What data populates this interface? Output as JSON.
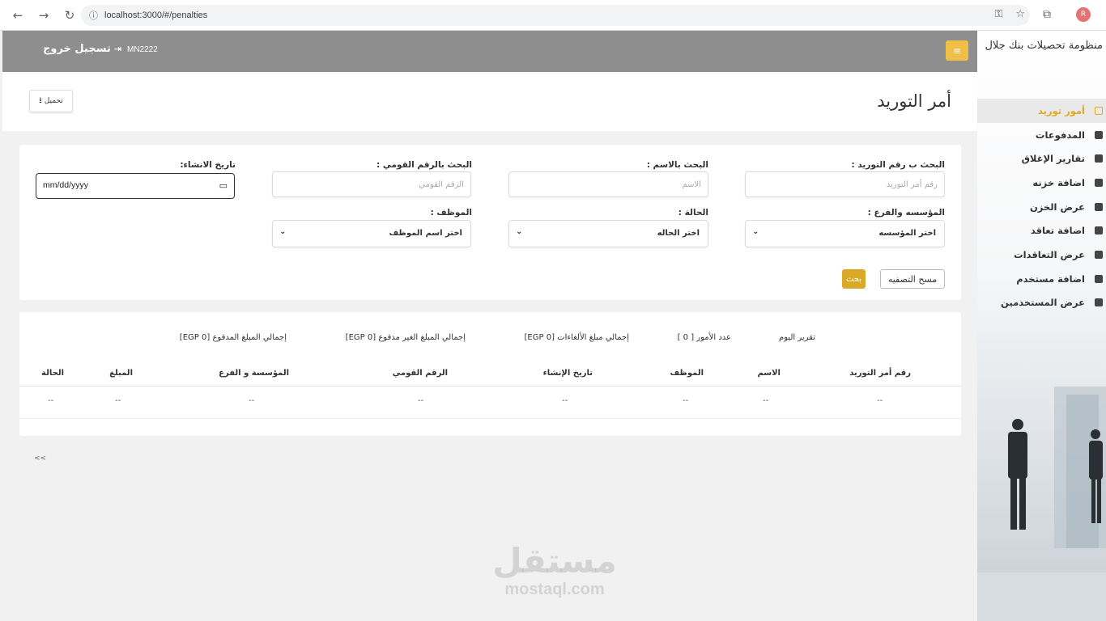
{
  "browser": {
    "url": "localhost:3000/#/penalties",
    "profile_initial": "R"
  },
  "sidebar": {
    "title": "منظومة تحصيلات بنك جلال",
    "items": [
      {
        "label": "أمور توريد",
        "icon": "invoice-icon",
        "active": true
      },
      {
        "label": "المدفوعات",
        "icon": "payments-icon"
      },
      {
        "label": "تقارير الإغلاق",
        "icon": "chart-icon"
      },
      {
        "label": "اضافة خزنه",
        "icon": "safe-add-icon"
      },
      {
        "label": "عرض الخزن",
        "icon": "safe-icon"
      },
      {
        "label": "اضافة تعاقد",
        "icon": "contract-add-icon"
      },
      {
        "label": "عرض التعاقدات",
        "icon": "contracts-icon"
      },
      {
        "label": "اضافة مستخدم",
        "icon": "user-add-icon"
      },
      {
        "label": "عرض المستخدمين",
        "icon": "users-icon"
      }
    ]
  },
  "header": {
    "user_code": "MN2222",
    "logout_label": "تسجيل خروج",
    "menu_icon": "hamburger-icon"
  },
  "page": {
    "title": "أمر التوريد",
    "download_label": "تحميل"
  },
  "filters": {
    "supply_no": {
      "label": "البحث ب رقم التوريد :",
      "placeholder": "رقم أمر التوريد"
    },
    "name": {
      "label": "البحث بالاسم :",
      "placeholder": "الاسم"
    },
    "national_id": {
      "label": "البحث بالرقم القومي :",
      "placeholder": "الرقم القومي"
    },
    "created_date": {
      "label": "تاريخ الانشاء:",
      "value": "mm/dd/yyyy"
    },
    "institution": {
      "label": "المؤسسه والفرع :",
      "value": "اختر المؤسسه"
    },
    "status": {
      "label": "الحالة :",
      "value": "اختر الحاله"
    },
    "employee": {
      "label": "الموظف :",
      "value": "اختر اسم الموظف"
    },
    "clear_label": "مسح التصفيه",
    "search_label": "بحث"
  },
  "summary": {
    "today_report": "تقرير اليوم",
    "orders_count": "عدد الأمور [ 0 ]",
    "total_cancellations": "إجمالي مبلغ الألغاءات [0 EGP]",
    "total_unpaid": "إجمالي المبلغ الغير مدفوع [0 EGP]",
    "total_paid": "إجمالي المبلغ المدفوع [0 EGP]"
  },
  "table": {
    "headers": [
      "رقم أمر التوريد",
      "الاسم",
      "الموظف",
      "تاريخ الإنشاء",
      "الرقم القومي",
      "المؤسسة و الفرع",
      "المبلغ",
      "الحالة"
    ],
    "rows": [
      [
        "--",
        "--",
        "--",
        "--",
        "--",
        "--",
        "--",
        "--"
      ]
    ]
  },
  "pager": {
    "prev_label": "<<"
  },
  "watermark": {
    "arabic": "مستقل",
    "latin": "mostaql.com"
  },
  "colors": {
    "accent": "#e0a91f",
    "topbar": "#8e8e8e",
    "search_button": "#d9a927"
  }
}
